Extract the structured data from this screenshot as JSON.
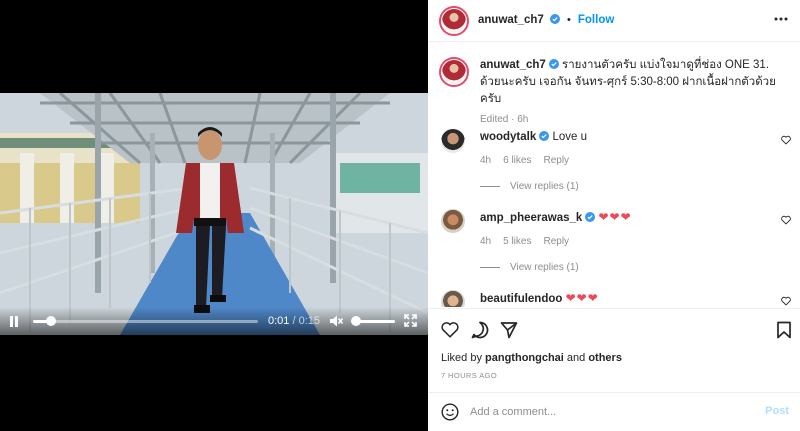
{
  "video": {
    "current_time": "0:01",
    "separator": " / ",
    "duration": "0:15",
    "progress_fraction": 0.08,
    "volume_fraction": 0.05
  },
  "post": {
    "author": "anuwat_ch7",
    "follow_label": "Follow",
    "bullet": "•",
    "caption_author": "anuwat_ch7",
    "caption_text": "รายงานตัวครับ แบ่งใจมาดูที่ช่อง ONE 31. ด้วยนะครับ เจอกัน จันทร-ศุกร์ 5:30-8:00 ฝากเนื้อฝากตัวด้วยครับ",
    "caption_meta": "Edited · 6h"
  },
  "comments": [
    {
      "user": "woodytalk",
      "verified": true,
      "text": "Love u",
      "time": "4h",
      "likes": "6 likes",
      "reply_label": "Reply",
      "view_replies": "View replies (1)"
    },
    {
      "user": "amp_pheerawas_k",
      "verified": true,
      "text": "❤❤❤",
      "time": "4h",
      "likes": "5 likes",
      "reply_label": "Reply",
      "view_replies": "View replies (1)"
    },
    {
      "user": "beautifulendoo",
      "verified": false,
      "text": "❤❤❤"
    }
  ],
  "likes": {
    "prefix": "Liked by ",
    "user": "pangthongchai",
    "middle": " and ",
    "others": "others"
  },
  "timestamp": "7 HOURS AGO",
  "composer": {
    "placeholder": "Add a comment...",
    "post_label": "Post"
  },
  "colors": {
    "accent": "#0095f6",
    "heart": "#ed4956",
    "verified": "#3897f0",
    "muted": "#8e8e8e"
  }
}
